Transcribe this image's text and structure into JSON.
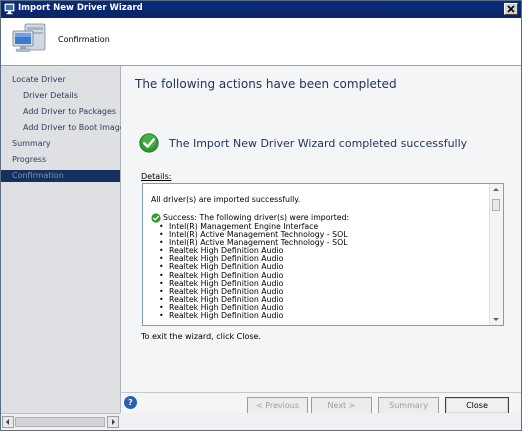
{
  "window": {
    "title": "Import New Driver Wizard",
    "icon": "computer-icon",
    "close_icon": "close-x-icon"
  },
  "header": {
    "title": "Confirmation",
    "icon": "computer-monitor-icon"
  },
  "nav": {
    "items": [
      {
        "label": "Locate Driver",
        "level": 0,
        "active": false
      },
      {
        "label": "Driver Details",
        "level": 1,
        "active": false
      },
      {
        "label": "Add Driver to Packages",
        "level": 1,
        "active": false
      },
      {
        "label": "Add Driver to Boot Images",
        "level": 1,
        "active": false
      },
      {
        "label": "Summary",
        "level": 0,
        "active": false
      },
      {
        "label": "Progress",
        "level": 0,
        "active": false
      },
      {
        "label": "Confirmation",
        "level": 0,
        "active": true
      }
    ]
  },
  "main": {
    "heading": "The following actions have been completed",
    "success_message": "The Import New Driver Wizard completed successfully",
    "success_icon": "green-checkmark-icon",
    "details_label": "Details:",
    "details": {
      "summary": "All driver(s) are imported successfully.",
      "success_line": "Success: The following driver(s) were imported:",
      "drivers": [
        "Intel(R) Management Engine Interface",
        "Intel(R) Active Management Technology - SOL",
        "Intel(R) Active Management Technology - SOL",
        "Realtek High Definition Audio",
        "Realtek High Definition Audio",
        "Realtek High Definition Audio",
        "Realtek High Definition Audio",
        "Realtek High Definition Audio",
        "Realtek High Definition Audio",
        "Realtek High Definition Audio",
        "Realtek High Definition Audio",
        "Realtek High Definition Audio"
      ]
    },
    "exit_text": "To exit the wizard, click Close."
  },
  "footer": {
    "help_icon": "help-question-icon",
    "buttons": {
      "previous": "< Previous",
      "next": "Next >",
      "summary": "Summary",
      "close": "Close"
    }
  }
}
